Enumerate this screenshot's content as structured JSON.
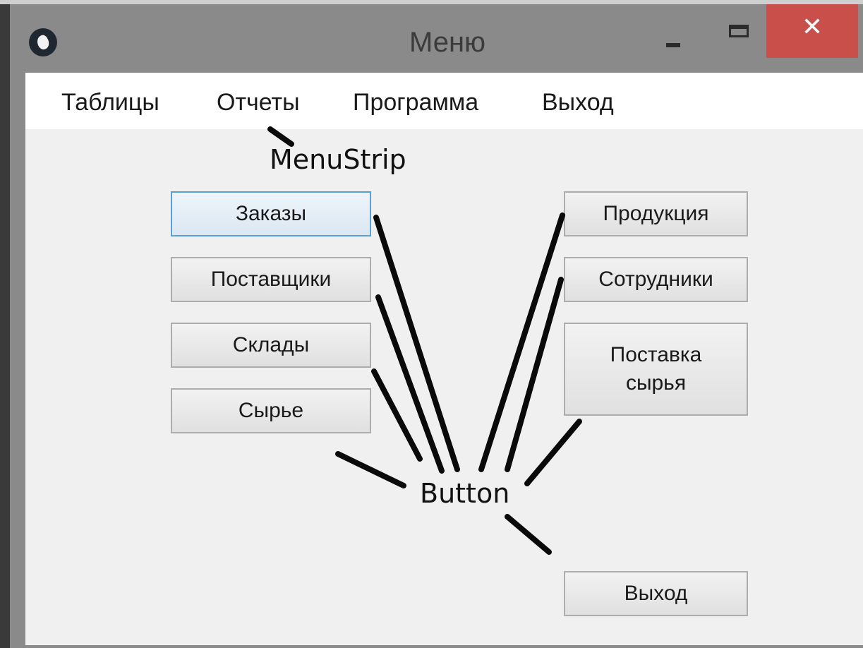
{
  "window": {
    "title": "Меню",
    "close_glyph": "✕"
  },
  "icons": {
    "app": "app-logo-icon",
    "minimize": "minimize-icon",
    "maximize": "maximize-icon",
    "close": "close-icon"
  },
  "menu": [
    {
      "id": "tables",
      "label": "Таблицы"
    },
    {
      "id": "reports",
      "label": "Отчеты"
    },
    {
      "id": "program",
      "label": "Программа"
    },
    {
      "id": "exit",
      "label": "Выход"
    }
  ],
  "annotations": {
    "menustrip": "MenuStrip",
    "button": "Button"
  },
  "buttons": {
    "orders": "Заказы",
    "suppliers": "Поставщики",
    "warehouses": "Склады",
    "raw": "Сырье",
    "products": "Продукция",
    "employees": "Сотрудники",
    "supply": "Поставка\nсырья",
    "exit": "Выход"
  },
  "colors": {
    "close_button": "#c9504a",
    "focus_border": "#5b9fd7"
  }
}
